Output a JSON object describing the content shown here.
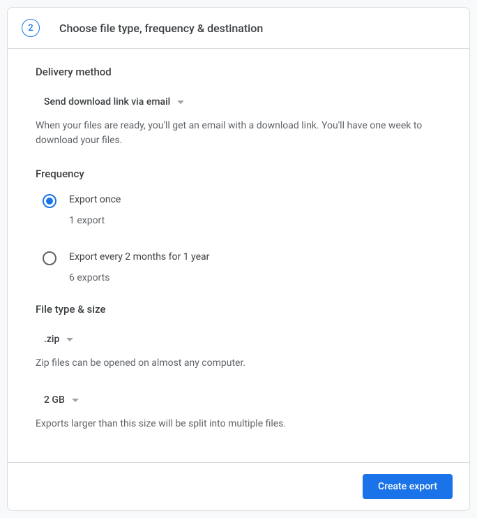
{
  "step": {
    "number": "2",
    "title": "Choose file type, frequency & destination"
  },
  "delivery": {
    "section_title": "Delivery method",
    "selected": "Send download link via email",
    "helper": "When your files are ready, you'll get an email with a download link. You'll have one week to download your files."
  },
  "frequency": {
    "section_title": "Frequency",
    "options": [
      {
        "label": "Export once",
        "sub": "1 export",
        "selected": true
      },
      {
        "label": "Export every 2 months for 1 year",
        "sub": "6 exports",
        "selected": false
      }
    ]
  },
  "filetype": {
    "section_title": "File type & size",
    "type_selected": ".zip",
    "type_helper": "Zip files can be opened on almost any computer.",
    "size_selected": "2 GB",
    "size_helper": "Exports larger than this size will be split into multiple files."
  },
  "footer": {
    "create_label": "Create export"
  }
}
